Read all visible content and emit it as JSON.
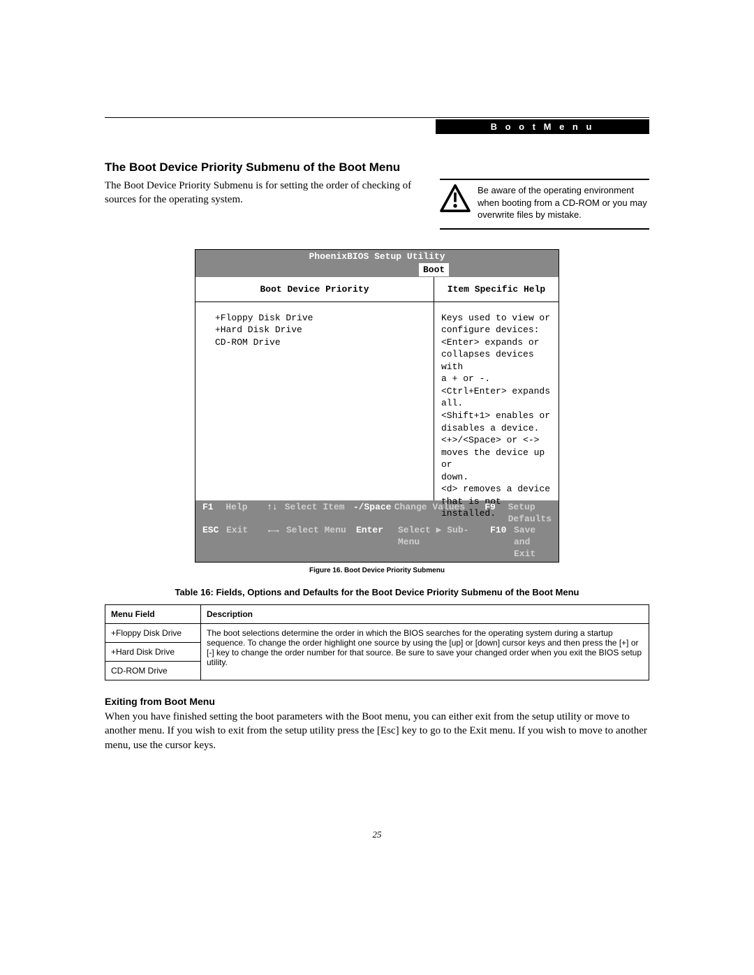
{
  "header": {
    "menu_label": "B o o t   M e n u"
  },
  "section_title": "The Boot Device Priority Submenu of the Boot Menu",
  "intro_para": "The Boot Device Priority Submenu is for setting the order of checking of sources for the operating system.",
  "warning_text": "Be aware of the operating environment when booting from a CD-ROM or you may overwrite files by mistake.",
  "bios": {
    "title": "PhoenixBIOS Setup Utility",
    "active_tab": "Boot",
    "left_header": "Boot Device Priority",
    "right_header": "Item Specific Help",
    "devices": [
      "+Floppy Disk Drive",
      "+Hard Disk Drive",
      " CD-ROM Drive"
    ],
    "help_lines": [
      "Keys used to view or",
      "configure devices:",
      "",
      "<Enter> expands or",
      "collapses devices with",
      "a + or -.",
      "<Ctrl+Enter> expands",
      "all.",
      "<Shift+1> enables or",
      "disables a device.",
      "<+>/<Space> or <->",
      "moves the device up or",
      "down.",
      "<d> removes a device",
      "that is not installed."
    ],
    "footer": {
      "r1": {
        "k1": "F1",
        "l1": "Help",
        "k2": "↑↓",
        "l2": "Select Item",
        "k3": "-/Space",
        "l3": "Change Values",
        "k4": "F9",
        "l4": "Setup Defaults"
      },
      "r2": {
        "k1": "ESC",
        "l1": "Exit",
        "k2": "←→",
        "l2": "Select Menu",
        "k3": "Enter",
        "l3": "Select ▶ Sub-Menu",
        "k4": "F10",
        "l4": "Save and Exit"
      }
    }
  },
  "figure_caption": "Figure 16.   Boot Device Priority Submenu",
  "table_caption": "Table 16: Fields, Options and Defaults for the Boot Device Priority Submenu of the Boot Menu",
  "table": {
    "h1": "Menu Field",
    "h2": "Description",
    "rows": [
      "+Floppy Disk Drive",
      "+Hard Disk Drive",
      "CD-ROM Drive"
    ],
    "desc": "The boot selections determine the order in which the BIOS searches for the operating system during a startup sequence. To change the order highlight one source by using the [up] or [down] cursor keys and then press the [+] or [-] key to change the order number for that source. Be sure to save your changed order when you exit the BIOS setup utility."
  },
  "exit_title": "Exiting from Boot Menu",
  "exit_para": "When you have finished setting the boot parameters with the Boot menu, you can either exit from the setup utility or move to another menu. If you wish to exit from the setup utility press the [Esc] key to go to the Exit menu. If you wish to move to another menu, use the cursor keys.",
  "page_number": "25"
}
